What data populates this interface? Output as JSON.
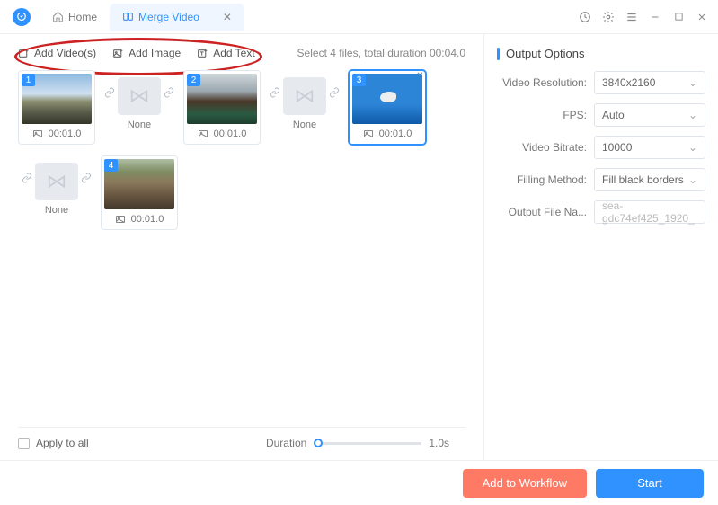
{
  "titlebar": {
    "tabs": [
      {
        "label": "Home",
        "active": false
      },
      {
        "label": "Merge Video",
        "active": true
      }
    ]
  },
  "toolbar": {
    "add_videos": "Add Video(s)",
    "add_image": "Add Image",
    "add_text": "Add Text",
    "status": "Select 4 files, total duration 00:04.0"
  },
  "clips": [
    {
      "index": "1",
      "duration": "00:01.0",
      "type": "image",
      "thumb": "sky1"
    },
    {
      "transition": true,
      "label": "None"
    },
    {
      "index": "2",
      "duration": "00:01.0",
      "type": "image",
      "thumb": "wood"
    },
    {
      "transition": true,
      "label": "None"
    },
    {
      "index": "3",
      "duration": "00:01.0",
      "type": "image",
      "thumb": "gull",
      "selected": true
    },
    {
      "transition": true,
      "label": "None"
    },
    {
      "index": "4",
      "duration": "00:01.0",
      "type": "image",
      "thumb": "castle"
    }
  ],
  "bottombar": {
    "apply_all": "Apply to all",
    "duration_label": "Duration",
    "duration_value": "1.0s"
  },
  "output": {
    "title": "Output Options",
    "rows": {
      "resolution": {
        "label": "Video Resolution:",
        "value": "3840x2160"
      },
      "fps": {
        "label": "FPS:",
        "value": "Auto"
      },
      "bitrate": {
        "label": "Video Bitrate:",
        "value": "10000"
      },
      "filling": {
        "label": "Filling Method:",
        "value": "Fill black borders"
      },
      "filename": {
        "label": "Output File Na...",
        "value": "sea-gdc74ef425_1920_"
      }
    }
  },
  "footer": {
    "workflow": "Add to Workflow",
    "start": "Start"
  }
}
